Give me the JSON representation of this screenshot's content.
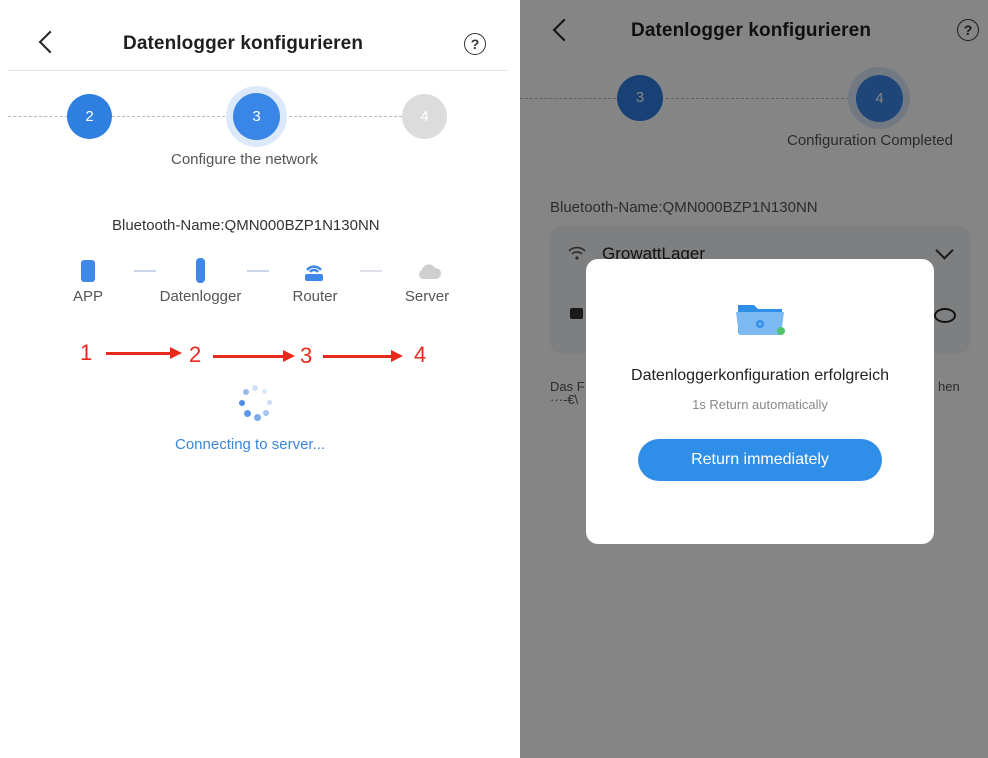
{
  "header": {
    "title": "Datenlogger konfigurieren",
    "help_glyph": "?"
  },
  "left": {
    "steps": [
      {
        "num": "2",
        "state": "done"
      },
      {
        "num": "3",
        "state": "active"
      },
      {
        "num": "4",
        "state": "pending"
      }
    ],
    "step_label": "Configure the network",
    "bluetooth_name": "Bluetooth-Name:QMN000BZP1N130NN",
    "devices": [
      {
        "label": "APP",
        "icon": "phone-icon"
      },
      {
        "label": "Datenlogger",
        "icon": "datalogger-icon"
      },
      {
        "label": "Router",
        "icon": "router-icon"
      },
      {
        "label": "Server",
        "icon": "cloud-icon"
      }
    ],
    "annotations": [
      "1",
      "2",
      "3",
      "4"
    ],
    "status": "Connecting to server..."
  },
  "right": {
    "steps": [
      {
        "num": "3",
        "state": "done"
      },
      {
        "num": "4",
        "state": "active"
      }
    ],
    "step_label": "Configuration Completed",
    "bluetooth_name": "Bluetooth-Name:QMN000BZP1N130NN",
    "wifi_name": "GrowattLager",
    "hint_left": "Das F",
    "hint_left2": "···-€\\",
    "hint_right": "hen",
    "dialog": {
      "title": "Datenloggerkonfiguration erfolgreich",
      "subtitle": "1s Return automatically",
      "button": "Return immediately",
      "icon": "folder-settings-icon"
    }
  },
  "colors": {
    "accent": "#2f8ee8",
    "step_active": "#3a86e6",
    "step_done": "#2f7fe0",
    "pending": "#dcdcdc",
    "annotation": "#e8291c"
  }
}
